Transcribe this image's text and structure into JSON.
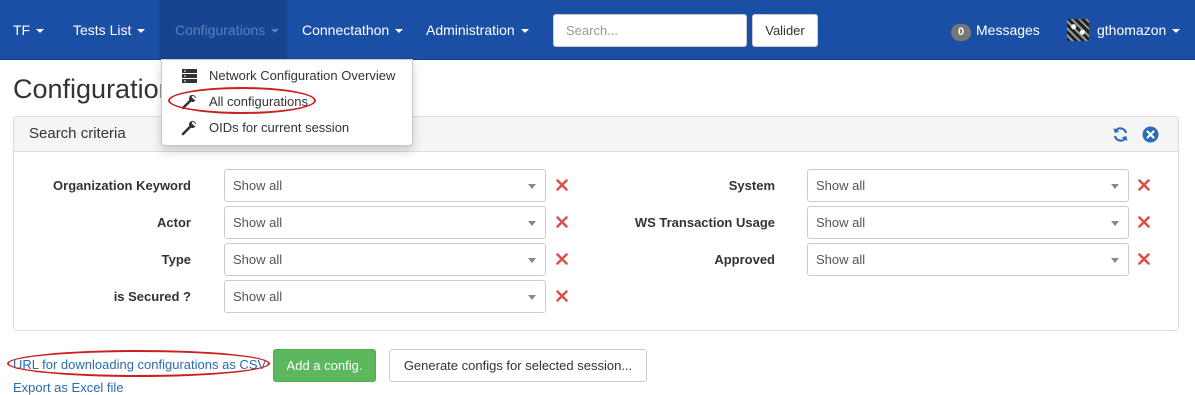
{
  "colors": {
    "navbar": "#1b4fa6",
    "accent_red": "#cc1f1f",
    "link": "#2a6bb3",
    "success": "#5cb85c"
  },
  "navbar": {
    "items": [
      {
        "label": "TF",
        "has_caret": true
      },
      {
        "label": "Tests List",
        "has_caret": true
      },
      {
        "label": "Configurations",
        "has_caret": true,
        "active": true
      },
      {
        "label": "Connectathon",
        "has_caret": true
      },
      {
        "label": "Administration",
        "has_caret": true
      }
    ],
    "search_placeholder": "Search...",
    "search_button": "Valider",
    "messages_count": "0",
    "messages_label": "Messages",
    "user_name": "gthomazon"
  },
  "dropdown": {
    "items": [
      {
        "label": "Network Configuration Overview",
        "icon": "server-icon"
      },
      {
        "label": "All configurations",
        "icon": "wrench-icon",
        "highlighted": true
      },
      {
        "label": "OIDs for current session",
        "icon": "wrench-icon"
      }
    ]
  },
  "page": {
    "title": "Configurations"
  },
  "search_panel": {
    "title": "Search criteria",
    "left_fields": [
      {
        "label": "Organization Keyword",
        "value": "Show all"
      },
      {
        "label": "Actor",
        "value": "Show all"
      },
      {
        "label": "Type",
        "value": "Show all"
      },
      {
        "label": "is Secured ?",
        "value": "Show all"
      }
    ],
    "right_fields": [
      {
        "label": "System",
        "value": "Show all"
      },
      {
        "label": "WS Transaction Usage",
        "value": "Show all"
      },
      {
        "label": "Approved",
        "value": "Show all"
      }
    ]
  },
  "actions": {
    "csv_link": "URL for downloading configurations as CSV",
    "add_config": "Add a config.",
    "generate_configs": "Generate configs for selected session..."
  },
  "partial_text": {
    "bottom_link": "Export as Excel file"
  }
}
